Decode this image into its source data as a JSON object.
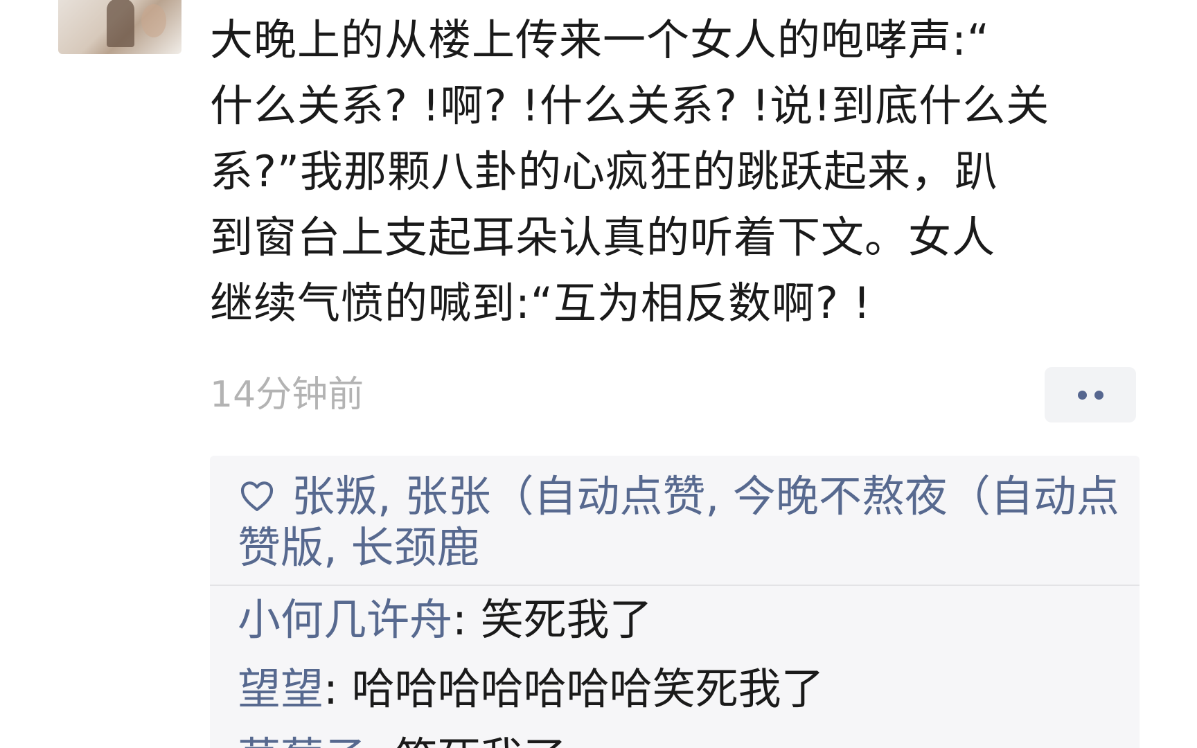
{
  "post": {
    "lines": [
      "大晚上的从楼上传来一个女人的咆哮声:“",
      "什么关系? !啊? !什么关系? !说!到底什么关",
      "系?”我那颗八卦的心疯狂的跳跃起来，趴",
      "到窗台上支起耳朵认真的听着下文。女人",
      "继续气愤的喊到:“互为相反数啊? !"
    ],
    "timestamp": "14分钟前"
  },
  "likes": {
    "icon": "heart-outline-icon",
    "names": [
      "张叛",
      "张张（自动点赞",
      "今晚不熬夜（自动点赞版",
      "长颈鹿"
    ],
    "separator": ", "
  },
  "comments": [
    {
      "author": "小何几许舟",
      "text": "笑死我了"
    },
    {
      "author": "望望",
      "text": "哈哈哈哈哈哈哈笑死我了"
    },
    {
      "author": "草莓子",
      "text": "笑死我了"
    }
  ],
  "colors": {
    "link_blue": "#57698f",
    "text": "#1a1a1a",
    "timestamp_gray": "#b3b3b3",
    "panel_bg": "#f6f6f8"
  }
}
